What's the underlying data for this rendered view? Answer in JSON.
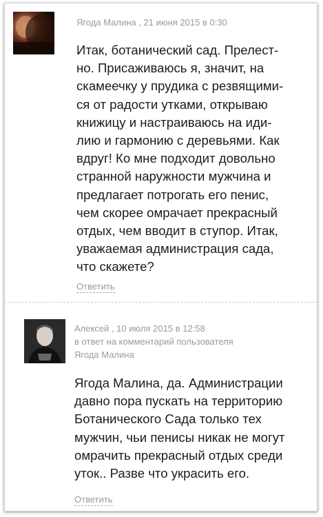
{
  "comments": [
    {
      "author": "Ягода Малина",
      "meta": "Ягода Малина , 21 июня 2015 в 0:30",
      "reply_to": "",
      "text": "Итак, ботанический сад. Прелест-\nно. Присаживаюсь я, значит, на\nскамеечку у прудика с резвящими-\nся от радости утками, открываю\nкнижицу и настраиваюсь на иди-\nлию и гармонию с деревьями. Как\nвдруг! Ко мне подходит довольно\nстранной наружности мужчина и\nпредлагает потрогать его пенис,\nчем скорее омрачает прекрасный\nотдых, чем вводит в ступор. Итак,\nуважаемая администрация сада,\nчто скажете?",
      "reply_label": "Ответить"
    },
    {
      "author": "Алексей",
      "meta": "Алексей , 10 июля 2015 в 12:58",
      "reply_to": "в ответ на комментарий пользователя\nЯгода Малина",
      "text": "Ягода Малина, да. Администрации\nдавно пора пускать на территорию\nБотанического Сада только тех\nмужчин, чьи пенисы никак не могут\nомрачить прекрасный отдых среди\nуток.. Разве что украсить его.",
      "reply_label": "Ответить"
    }
  ]
}
